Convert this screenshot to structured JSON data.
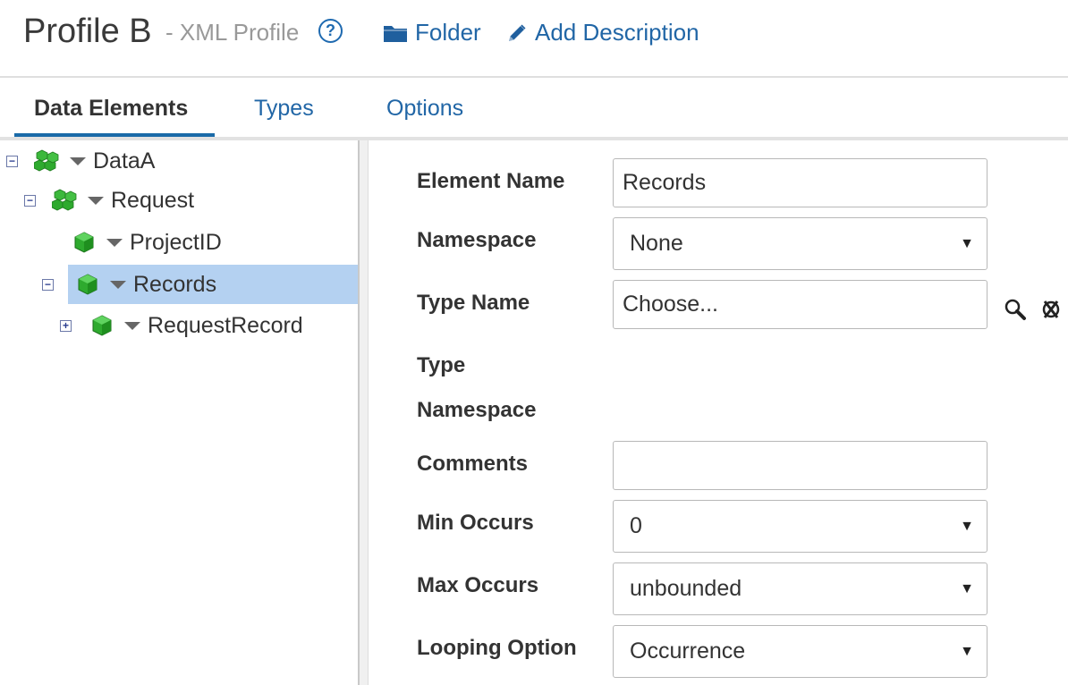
{
  "header": {
    "title": "Profile B",
    "subtitle": "- XML Profile",
    "help_icon": "?",
    "folder_link": "Folder",
    "add_description_link": "Add Description"
  },
  "tabs": [
    {
      "label": "Data Elements",
      "active": true
    },
    {
      "label": "Types",
      "active": false
    },
    {
      "label": "Options",
      "active": false
    }
  ],
  "tree": {
    "nodes": [
      {
        "label": "DataA",
        "toggle": "−",
        "icon": "element-group-icon",
        "selected": false
      },
      {
        "label": "Request",
        "toggle": "−",
        "icon": "element-group-icon",
        "selected": false
      },
      {
        "label": "ProjectID",
        "toggle": "",
        "icon": "element-icon",
        "selected": false
      },
      {
        "label": "Records",
        "toggle": "−",
        "icon": "element-icon",
        "selected": true
      },
      {
        "label": "RequestRecord",
        "toggle": "+",
        "icon": "element-icon",
        "selected": false
      }
    ]
  },
  "form": {
    "element_name": {
      "label": "Element Name",
      "value": "Records"
    },
    "namespace": {
      "label": "Namespace",
      "value": "None"
    },
    "type_name": {
      "label": "Type Name",
      "value": "Choose..."
    },
    "type_namespace": {
      "label_line1": "Type",
      "label_line2": "Namespace"
    },
    "comments": {
      "label": "Comments",
      "value": ""
    },
    "min_occurs": {
      "label": "Min Occurs",
      "value": "0"
    },
    "max_occurs": {
      "label": "Max Occurs",
      "value": "unbounded"
    },
    "looping_option": {
      "label": "Looping Option",
      "value": "Occurrence"
    },
    "dropdown_arrow": "▼"
  },
  "colors": {
    "link": "#2166a6",
    "selected_row": "#b4d1f1",
    "tab_underline": "#1a6aa8",
    "element_icon_green": "#2eaa2e"
  }
}
